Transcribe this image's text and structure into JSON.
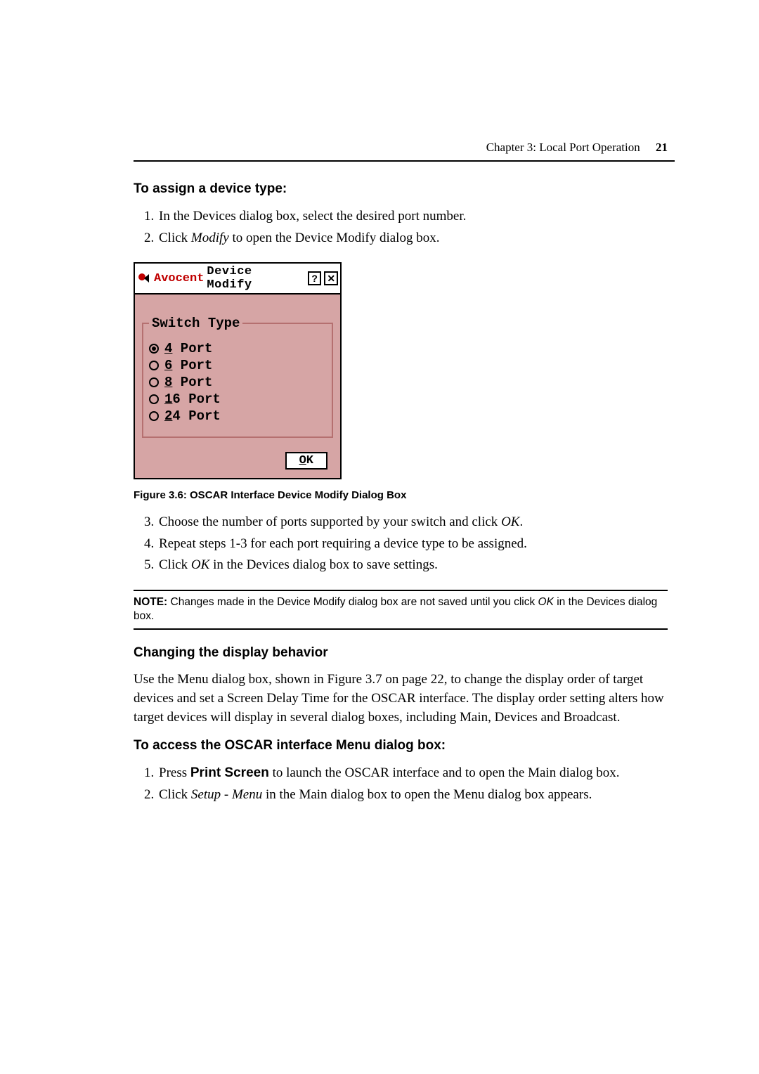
{
  "header": {
    "chapter": "Chapter 3: Local Port Operation",
    "page_number": "21"
  },
  "sections": {
    "assign_title": "To assign a device type:",
    "assign_steps": {
      "s1": "In the Devices dialog box, select the desired port number.",
      "s2_pre": "Click ",
      "s2_em": "Modify",
      "s2_post": " to open the Device Modify dialog box."
    },
    "figure_caption": "Figure 3.6: OSCAR Interface Device Modify Dialog Box",
    "after_steps": {
      "s3_pre": "Choose the number of ports supported by your switch and click ",
      "s3_em": "OK",
      "s3_post": ".",
      "s4": "Repeat steps 1-3 for each port requiring a device type to be assigned.",
      "s5_pre": "Click ",
      "s5_em": "OK",
      "s5_post": " in the Devices dialog box to save settings."
    },
    "note": {
      "label": "NOTE:",
      "text_pre": " Changes made in the Device Modify dialog box are not saved until you click ",
      "text_em": "OK",
      "text_post": " in the Devices dialog box."
    },
    "changing_title": "Changing the display behavior",
    "changing_para": "Use the Menu dialog box, shown in Figure 3.7 on page 22, to change the display order of target devices and set a Screen Delay Time for the OSCAR interface. The display order setting alters how target devices will display in several dialog boxes, including Main, Devices and Broadcast.",
    "access_title": "To access the OSCAR interface Menu dialog box:",
    "access_steps": {
      "s1_pre": "Press ",
      "s1_bold": "Print Screen",
      "s1_post": " to launch the OSCAR interface and to open the Main dialog box.",
      "s2_pre": "Click ",
      "s2_em": "Setup - Menu",
      "s2_post": " in the Main dialog box to open the Menu dialog box appears."
    }
  },
  "dialog": {
    "brand": "Avocent",
    "title": "Device Modify",
    "help_btn": "?",
    "close_btn": "✕",
    "fieldset_legend": "Switch Type",
    "options": {
      "o1": {
        "accel": "4",
        "rest": " Port",
        "checked": true
      },
      "o2": {
        "accel": "6",
        "rest": " Port",
        "checked": false
      },
      "o3": {
        "accel": "8",
        "rest": " Port",
        "checked": false
      },
      "o4": {
        "accel": "1",
        "rest": "6 Port",
        "checked": false
      },
      "o5": {
        "accel": "2",
        "rest": "4 Port",
        "checked": false
      }
    },
    "ok_accel": "O",
    "ok_rest": "K"
  }
}
